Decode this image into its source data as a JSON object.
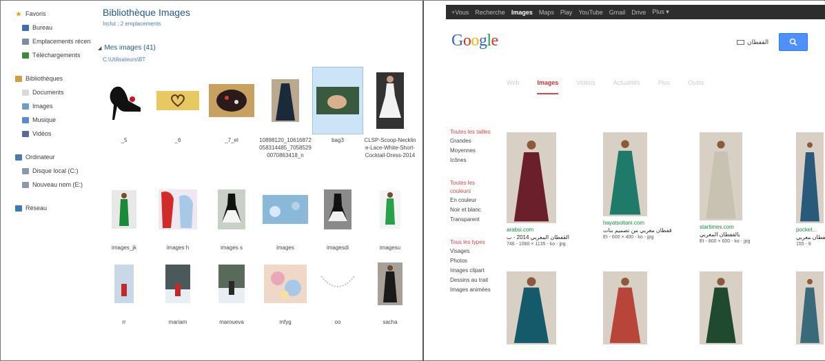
{
  "explorer": {
    "nav": {
      "favorites": [
        {
          "label": "Favoris",
          "icon": "star-icon"
        },
        {
          "label": "Bureau",
          "icon": "desktop-icon"
        },
        {
          "label": "Emplacements récen",
          "icon": "recent-places-icon"
        },
        {
          "label": "Téléchargements",
          "icon": "downloads-icon"
        }
      ],
      "libraries": [
        {
          "label": "Bibliothèques",
          "icon": "libraries-icon"
        },
        {
          "label": "Documents",
          "icon": "documents-icon"
        },
        {
          "label": "Images",
          "icon": "pictures-icon"
        },
        {
          "label": "Musique",
          "icon": "music-icon"
        },
        {
          "label": "Vidéos",
          "icon": "videos-icon"
        }
      ],
      "computer": [
        {
          "label": "Ordinateur",
          "icon": "computer-icon"
        },
        {
          "label": "Disque local (C:)",
          "icon": "drive-icon"
        },
        {
          "label": "Nouveau nom (E:)",
          "icon": "drive-icon"
        }
      ],
      "network": [
        {
          "label": "Réseau",
          "icon": "network-icon"
        }
      ]
    },
    "library_title": "Bibliothèque Images",
    "library_subtitle": "Inclut : 2 emplacements",
    "folder_title": "Mes images (41)",
    "folder_subtitle": "C:\\Utilisateurs\\BT",
    "thumbnails": [
      {
        "label": "_5",
        "art": "shoe"
      },
      {
        "label": "_6",
        "art": "heart-plate"
      },
      {
        "label": "_7_el",
        "art": "embellished"
      },
      {
        "label": "10898120_10616872058314485_70585290070863418_n",
        "art": "dark-dress"
      },
      {
        "label": "bag3",
        "art": "hands",
        "selected": true
      },
      {
        "label": "CLSP-Scoop-Neckline-Lace-White-Short-Cocktail-Dress-2014",
        "art": "white-dress"
      },
      {
        "label": "images_jk",
        "art": "green-dress"
      },
      {
        "label": "images h",
        "art": "anime"
      },
      {
        "label": "images s",
        "art": "bw-dress"
      },
      {
        "label": "images",
        "art": "frozen"
      },
      {
        "label": "imagesdi",
        "art": "bw-dress2"
      },
      {
        "label": "imagesu",
        "art": "green-dress2"
      },
      {
        "label": "rr",
        "art": "snow-red"
      },
      {
        "label": "mariam",
        "art": "snow-red2"
      },
      {
        "label": "maroueva",
        "art": "snow-red3"
      },
      {
        "label": "mfyg",
        "art": "flowers"
      },
      {
        "label": "oo",
        "art": "necklace"
      },
      {
        "label": "sacha",
        "art": "dark-dress2"
      }
    ]
  },
  "browser": {
    "topbar": [
      "+Vous",
      "Recherche",
      "Images",
      "Maps",
      "Play",
      "YouTube",
      "Gmail",
      "Drive",
      "Plus ▾"
    ],
    "topbar_active": "Images",
    "logo": [
      {
        "ch": "G",
        "color": "#3366cc"
      },
      {
        "ch": "o",
        "color": "#d93025"
      },
      {
        "ch": "o",
        "color": "#f2b600"
      },
      {
        "ch": "g",
        "color": "#3366cc"
      },
      {
        "ch": "l",
        "color": "#1e9e4a"
      },
      {
        "ch": "e",
        "color": "#d93025"
      }
    ],
    "search_query": "القفطان",
    "search_icon": "search-icon",
    "tabs": [
      "Web",
      "Images",
      "Vidéos",
      "Actualités",
      "Plus",
      "Outils"
    ],
    "tab_active": "Images",
    "filters": [
      {
        "head": [
          "Toutes les tailles"
        ],
        "items": [
          "Grandes",
          "Moyennes",
          "Icônes"
        ]
      },
      {
        "head": [
          "Toutes les",
          "couleurs"
        ],
        "items": [
          "En couleur",
          "Noir et blanc",
          "Transparent"
        ]
      },
      {
        "head": [
          "Tous les types"
        ],
        "items": [
          "Visages",
          "Photos",
          "Images clipart",
          "Dessins au trait",
          "Images animées"
        ]
      }
    ],
    "results": [
      {
        "site": "arabsi.com",
        "title": "القفطان المغربي 2014 - ب",
        "meta": "746 - 1080 × 1135 - ko - jpg",
        "color": "#6b1f2a"
      },
      {
        "site": "hayatsoltani.com",
        "title": "قفطان مغربي من تصميم بنات",
        "meta": "Et - 600 × 400 - ko - jpg",
        "color": "#1f7a6a"
      },
      {
        "site": "startimes.com",
        "title": "بالقفطان المغربي",
        "meta": "Et - 800 × 600 - ko - jpg",
        "color": "#c8c2b2"
      },
      {
        "site": "pocket...",
        "title": "قفطان مغربي",
        "meta": "155 - 8",
        "color": "#2a5a7a"
      },
      {
        "site": "",
        "title": "",
        "meta": "",
        "color": "#155a6a"
      },
      {
        "site": "",
        "title": "",
        "meta": "",
        "color": "#b8453a"
      },
      {
        "site": "",
        "title": "",
        "meta": "",
        "color": "#1f4a30"
      },
      {
        "site": "",
        "title": "",
        "meta": "",
        "color": "#3a6a7a"
      }
    ]
  }
}
